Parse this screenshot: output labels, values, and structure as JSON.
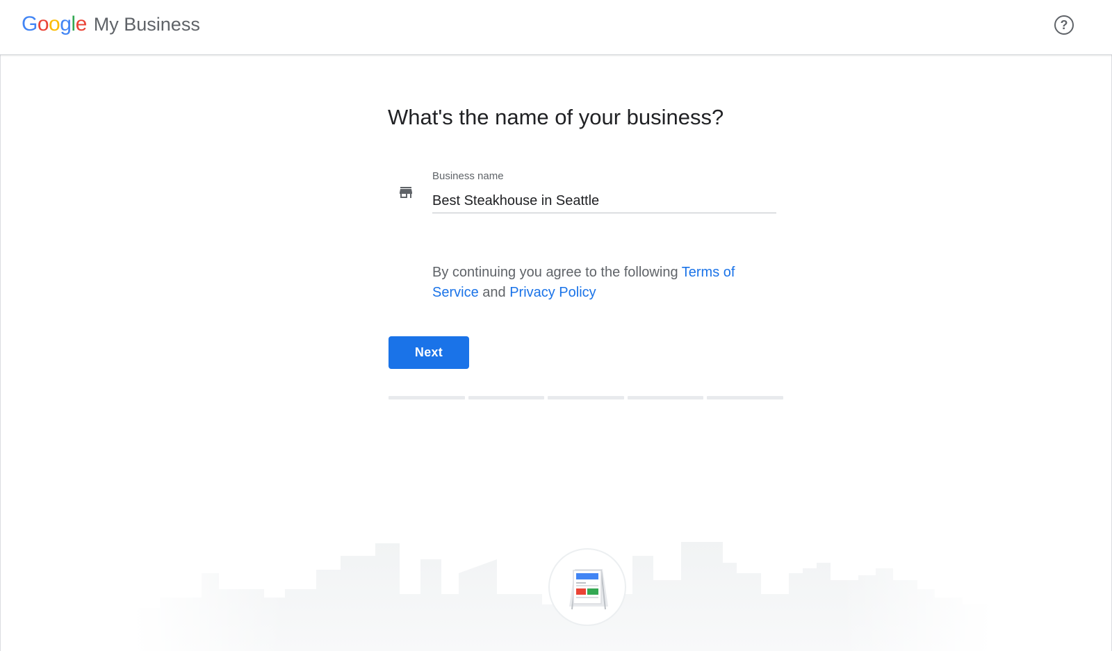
{
  "header": {
    "logo_letters": [
      {
        "char": "G",
        "color": "#4285F4"
      },
      {
        "char": "o",
        "color": "#EA4335"
      },
      {
        "char": "o",
        "color": "#FBBC05"
      },
      {
        "char": "g",
        "color": "#4285F4"
      },
      {
        "char": "l",
        "color": "#34A853"
      },
      {
        "char": "e",
        "color": "#EA4335"
      }
    ],
    "product_name": "My Business",
    "help_icon": "help-circle-icon",
    "help_glyph": "?"
  },
  "form": {
    "title": "What's the name of your business?",
    "field_icon": "storefront-icon",
    "field_label": "Business name",
    "field_value": "Best Steakhouse in Seattle",
    "terms_prefix": "By continuing you agree to the following ",
    "terms_link": "Terms of Service",
    "terms_middle": " and ",
    "privacy_link": "Privacy Policy",
    "next_label": "Next"
  },
  "progress": {
    "total_steps": 5
  },
  "colors": {
    "accent": "#1a73e8",
    "text_primary": "#202124",
    "text_secondary": "#5f6368"
  },
  "illustration": {
    "name": "city-skyline",
    "badge_icon": "signboard-icon"
  }
}
